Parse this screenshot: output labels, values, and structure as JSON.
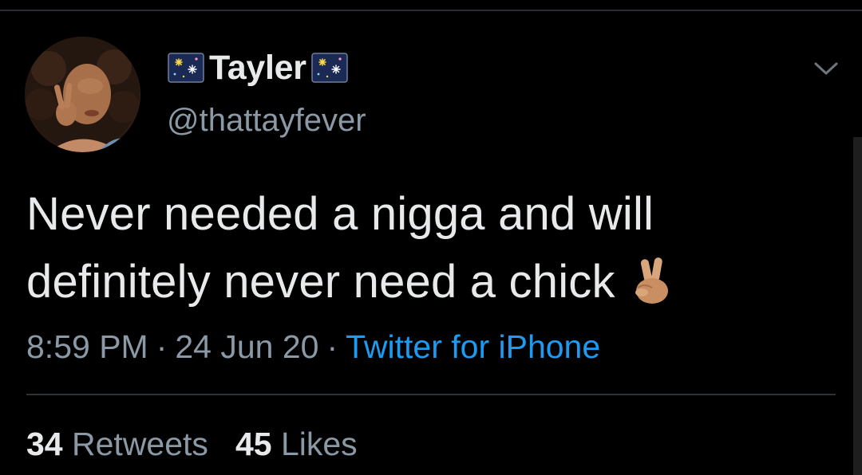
{
  "author": {
    "display_name": "Tayler",
    "handle": "@thattayfever",
    "name_emoji_icon": "fireworks-icon"
  },
  "tweet": {
    "text_line1": "Never needed a nigga and will",
    "text_line2": "definitely never need a chick",
    "trailing_emoji_icon": "victory-hand-icon"
  },
  "meta": {
    "time": "8:59 PM",
    "separator": "·",
    "date": "24 Jun 20",
    "source": "Twitter for iPhone"
  },
  "stats": {
    "retweets_count": "34",
    "retweets_label": "Retweets",
    "likes_count": "45",
    "likes_label": "Likes"
  },
  "colors": {
    "background": "#000000",
    "text_primary": "#e7e9ea",
    "text_secondary": "#8b98a5",
    "link": "#1d9bf0",
    "divider": "#2f3336"
  }
}
